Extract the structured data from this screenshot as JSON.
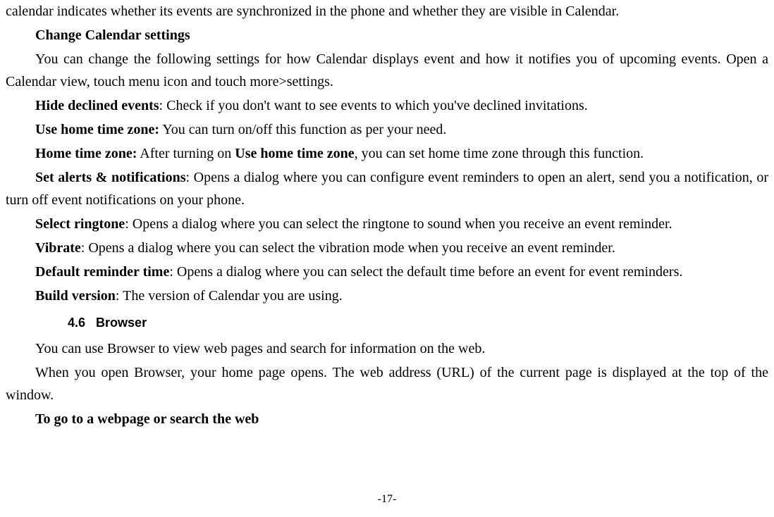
{
  "paragraphs": {
    "p1": "calendar indicates whether its events are synchronized in the phone and whether they are visible in Calendar.",
    "p2_bold": "Change Calendar settings",
    "p3": "You can change the following settings for how Calendar displays event and how it notifies you of upcoming events. Open a Calendar view, touch menu icon and touch more>settings.",
    "p4_bold": "Hide declined events",
    "p4_rest": ": Check if you don't want to see events to which you've declined invitations.",
    "p5_bold": "Use home time zone:",
    "p5_rest": " You can turn on/off this function as per your need.",
    "p6_bold": "Home time zone:",
    "p6_mid": " After turning on ",
    "p6_bold2": "Use home time zone",
    "p6_rest": ", you can set home time zone through this function.",
    "p7_bold": "Set alerts & notifications",
    "p7_rest": ": Opens a dialog where you can configure event reminders to open an alert, send you a notification, or turn off event notifications on your phone.",
    "p8_bold": "Select ringtone",
    "p8_rest": ": Opens a dialog where you can select the ringtone to sound when you receive an event reminder.",
    "p9_bold": "Vibrate",
    "p9_rest": ": Opens a dialog where you can select the vibration mode when you receive an event reminder.",
    "p10_bold": "Default reminder time",
    "p10_rest": ": Opens a dialog where you can select the default time before an event for event reminders.",
    "p11_bold": "Build version",
    "p11_rest": ": The version of Calendar you are using.",
    "section_num": "4.6",
    "section_title": "Browser",
    "p12": "You can use Browser to view web pages and search for information on the web.",
    "p13": "When you open Browser, your home page opens. The web address (URL) of the current page is displayed at the top of the window.",
    "p14_bold": "To go to a webpage or search the web"
  },
  "footer": "-17-"
}
